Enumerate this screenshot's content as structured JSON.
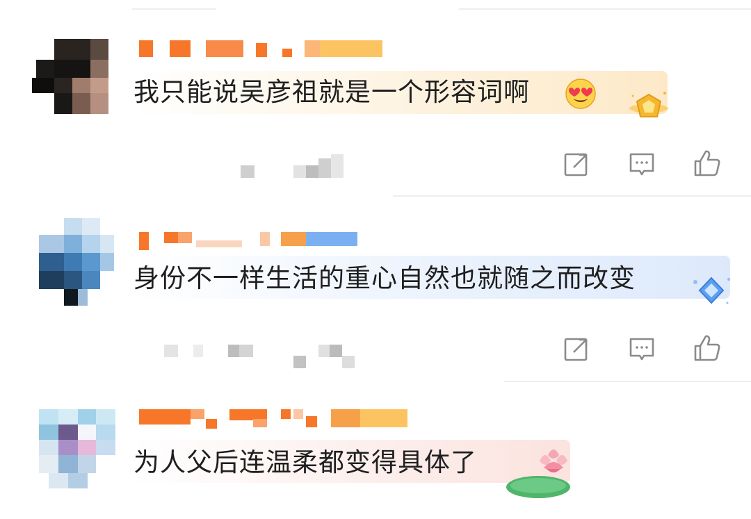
{
  "comments": [
    {
      "text": "我只能说吴彦祖就是一个形容词啊",
      "emoji": "😍",
      "badge": "gold-star-badge",
      "actions": {
        "repost": "share-icon",
        "reply": "comment-icon",
        "like": "thumb-up-icon"
      }
    },
    {
      "text": "身份不一样生活的重心自然也就随之而改变",
      "badge": "blue-diamond-badge",
      "actions": {
        "repost": "share-icon",
        "reply": "comment-icon",
        "like": "thumb-up-icon"
      }
    },
    {
      "text": "为人父后连温柔都变得具体了",
      "badge": "lotus-flower-badge"
    }
  ],
  "colors": {
    "text": "#1f1f1f",
    "icon": "#8a8a8a",
    "bubble_gold": "#fdf1dc",
    "bubble_blue": "#e6effc",
    "bubble_pink": "#fbe9e6",
    "name_orange": "#f7772a",
    "name_blue": "#5a9ff0"
  }
}
